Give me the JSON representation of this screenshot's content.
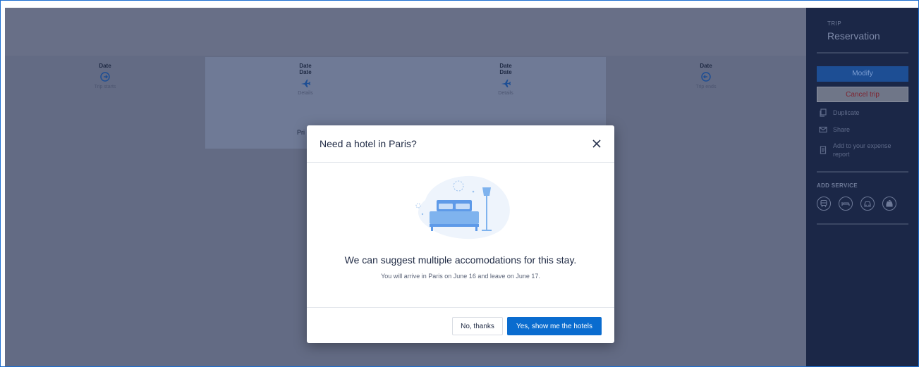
{
  "timeline": [
    {
      "date_lines": [
        "Date"
      ],
      "icon": "trip-start-icon",
      "label": "Trip starts"
    },
    {
      "date_lines": [
        "Date",
        "Date"
      ],
      "icon": "flight-icon",
      "label": "Details"
    },
    {
      "date_lines": [
        "Date",
        "Date"
      ],
      "icon": "flight-icon",
      "label": "Details"
    },
    {
      "date_lines": [
        "Date"
      ],
      "icon": "trip-end-icon",
      "label": "Trip ends"
    }
  ],
  "price_label": "Pri",
  "sidebar": {
    "kicker": "TRIP",
    "title": "Reservation",
    "modify_label": "Modify",
    "cancel_label": "Cancel trip",
    "actions": [
      {
        "icon": "duplicate-icon",
        "label": "Duplicate"
      },
      {
        "icon": "mail-icon",
        "label": "Share"
      },
      {
        "icon": "receipt-icon",
        "label": "Add to your expense report"
      }
    ],
    "add_service_title": "ADD SERVICE",
    "services": [
      "train-icon",
      "hotel-icon",
      "car-icon",
      "taxi-icon"
    ]
  },
  "modal": {
    "title": "Need a hotel in Paris?",
    "heading": "We can suggest multiple accomodations for this stay.",
    "subtext": "You will arrive in Paris on June 16 and leave on June 17.",
    "no_label": "No, thanks",
    "yes_label": "Yes, show me the hotels"
  },
  "colors": {
    "accent": "#0a6ccf",
    "sidebar_bg": "#1b2747",
    "overlay_bg": "#636b84"
  }
}
